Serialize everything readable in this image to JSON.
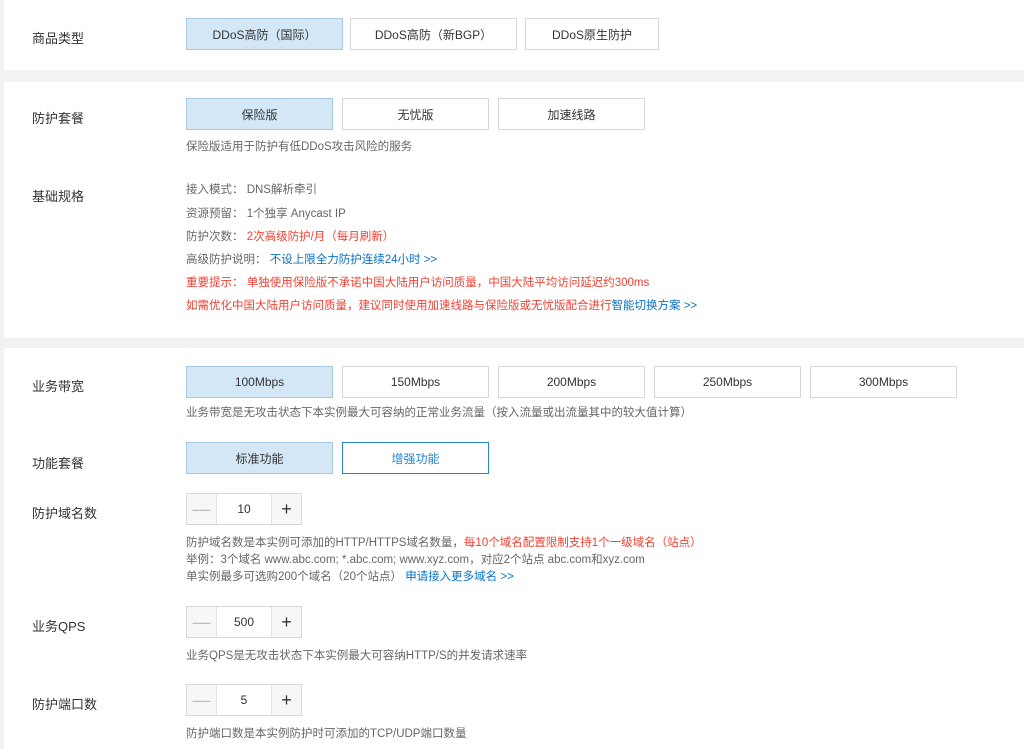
{
  "product_type": {
    "label": "商品类型",
    "options": [
      "DDoS高防（国际）",
      "DDoS高防（新BGP）",
      "DDoS原生防护"
    ]
  },
  "protection_plan": {
    "label": "防护套餐",
    "options": [
      "保险版",
      "无忧版",
      "加速线路"
    ],
    "description": "保险版适用于防护有低DDoS攻击风险的服务"
  },
  "basic_spec": {
    "label": "基础规格",
    "access_mode": "接入模式：  DNS解析牵引",
    "resource": "资源预留：  1个独享 Anycast IP",
    "protect_count_label": "防护次数：",
    "protect_count_value": "2次高级防护/月（每月刷新）",
    "advanced_label": "高级防护说明：",
    "advanced_link": "不设上限全力防护连续24小时 >>",
    "important_notice": "重要提示：  单独使用保险版不承诺中国大陆用户访问质量，中国大陆平均访问延迟约300ms",
    "optimize_text": "如需优化中国大陆用户访问质量，建议同时使用加速线路与保险版或无忧版配合进行",
    "optimize_link": "智能切换方案 >>"
  },
  "bandwidth": {
    "label": "业务带宽",
    "options": [
      "100Mbps",
      "150Mbps",
      "200Mbps",
      "250Mbps",
      "300Mbps"
    ],
    "description": "业务带宽是无攻击状态下本实例最大可容纳的正常业务流量（按入流量或出流量其中的较大值计算）"
  },
  "function_plan": {
    "label": "功能套餐",
    "options": [
      "标准功能",
      "增强功能"
    ]
  },
  "domains": {
    "label": "防护域名数",
    "value": "10",
    "desc1_a": "防护域名数是本实例可添加的HTTP/HTTPS域名数量，",
    "desc1_b": "每10个域名配置限制支持1个一级域名（站点）",
    "desc2": "举例：3个域名 www.abc.com; *.abc.com; www.xyz.com，对应2个站点 abc.com和xyz.com",
    "desc3_a": "单实例最多可选购200个域名（20个站点）",
    "desc3_link": "申请接入更多域名 >>"
  },
  "qps": {
    "label": "业务QPS",
    "value": "500",
    "description": "业务QPS是无攻击状态下本实例最大可容纳HTTP/S的并发请求速率"
  },
  "ports": {
    "label": "防护端口数",
    "value": "5",
    "description": "防护端口数是本实例防护时可添加的TCP/UDP端口数量"
  },
  "stepper_minus": "—",
  "stepper_plus": "+"
}
